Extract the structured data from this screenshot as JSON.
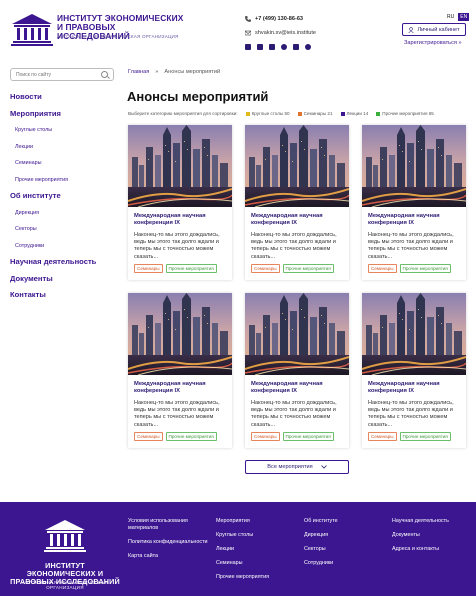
{
  "header": {
    "logo_title": "ИНСТИТУТ ЭКОНОМИЧЕСКИХ И ПРАВОВЫХ ИССЛЕДОВАНИЙ",
    "logo_subtitle": "АВТОНОМНАЯ НЕКОММЕРЧЕСКАЯ ОРГАНИЗАЦИЯ",
    "phone": "+7 (499) 130-86-63",
    "email": "shvakin.sv@ieis.institute",
    "lang_ru": "RU",
    "lang_en": "EN",
    "cabinet_label": "Личный кабинет",
    "register_label": "Зарегистрироваться »"
  },
  "search": {
    "placeholder": "Поиск по сайту"
  },
  "sidebar": {
    "news": "Новости",
    "events": "Мероприятия",
    "events_sub": [
      "Круглые столы",
      "Лекции",
      "Семинары",
      "Прочие мероприятия"
    ],
    "about": "Об институте",
    "about_sub": [
      "Дирекция",
      "Секторы",
      "Сотрудники"
    ],
    "research": "Научная деятельность",
    "documents": "Документы",
    "contacts": "Контакты"
  },
  "breadcrumb": {
    "home": "Главная",
    "sep": "»",
    "current": "Анонсы мероприятий"
  },
  "page_title": "Анонсы мероприятий",
  "filters": {
    "label": "Выберите категорию мероприятия для сортировки:",
    "items": [
      {
        "label": "Круглые столы 50",
        "color": "#e0b820"
      },
      {
        "label": "Семинары 21",
        "color": "#e0742c"
      },
      {
        "label": "Лекции 14",
        "color": "#3c1690"
      },
      {
        "label": "Прочие мероприятия 65",
        "color": "#3cae3c"
      }
    ]
  },
  "cards": [
    {
      "title": "Международная научная конференция IX",
      "text": "Наконец-то мы этого дождались, ведь мы этого так долго ждали и теперь мы с точностью можем сказать...",
      "tag1": "Семинары",
      "tag2": "Прочие мероприятия"
    },
    {
      "title": "Международная научная конференция IX",
      "text": "Наконец-то мы этого дождались, ведь мы этого так долго ждали и теперь мы с точностью можем сказать...",
      "tag1": "Семинары",
      "tag2": "Прочие мероприятия"
    },
    {
      "title": "Международная научная конференция IX",
      "text": "Наконец-то мы этого дождались, ведь мы этого так долго ждали и теперь мы с точностью можем сказать...",
      "tag1": "Семинары",
      "tag2": "Прочие мероприятия"
    },
    {
      "title": "Международная научная конференция IX",
      "text": "Наконец-то мы этого дождались, ведь мы этого так долго ждали и теперь мы с точностью можем сказать...",
      "tag1": "Семинары",
      "tag2": "Прочие мероприятия"
    },
    {
      "title": "Международная научная конференция IX",
      "text": "Наконец-то мы этого дождались, ведь мы этого так долго ждали и теперь мы с точностью можем сказать...",
      "tag1": "Семинары",
      "tag2": "Прочие мероприятия"
    },
    {
      "title": "Международная научная конференция IX",
      "text": "Наконец-то мы этого дождались, ведь мы этого так долго ждали и теперь мы с точностью можем сказать...",
      "tag1": "Семинары",
      "tag2": "Прочие мероприятия"
    }
  ],
  "all_events_label": "Все мероприятия",
  "footer": {
    "logo_title": "ИНСТИТУТ ЭКОНОМИЧЕСКИХ И ПРАВОВЫХ ИССЛЕДОВАНИЙ",
    "logo_subtitle": "АВТОНОМНАЯ НЕКОММЕРЧЕСКАЯ ОРГАНИЗАЦИЯ",
    "col1": [
      "Условия использования материалов",
      "Политика конфиденциальности",
      "Карта сайта"
    ],
    "col2": [
      "Мероприятия",
      "Круглые столы",
      "Лекции",
      "Семинары",
      "Прочие мероприятия"
    ],
    "col3": [
      "Об институте",
      "Дирекция",
      "Секторы",
      "Сотрудники"
    ],
    "col4": [
      "Научная деятельность",
      "Документы",
      "Адреса и контакты"
    ]
  },
  "colors": {
    "brand": "#3c1690",
    "seminar": "#e0742c",
    "other": "#3cae3c"
  }
}
